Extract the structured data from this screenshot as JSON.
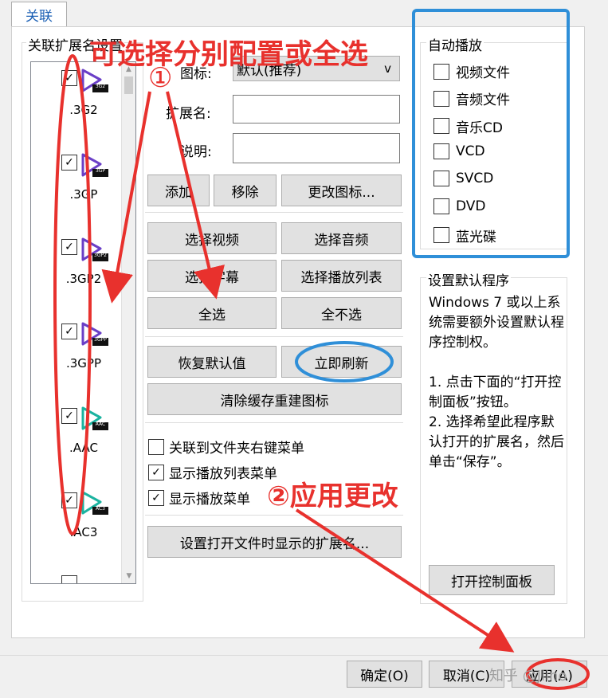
{
  "tab": {
    "label": "关联"
  },
  "left_group": {
    "legend": "关联扩展名设置",
    "extensions": [
      {
        "name": ".3G2",
        "badge": "3G2",
        "checked": true,
        "icon": "purple-play-icon",
        "color": "#6a3fc7"
      },
      {
        "name": ".3GP",
        "badge": "3GP",
        "checked": true,
        "icon": "purple-play-icon",
        "color": "#6a3fc7"
      },
      {
        "name": ".3GP2",
        "badge": "3GP2",
        "checked": true,
        "icon": "purple-play-icon",
        "color": "#6a3fc7"
      },
      {
        "name": ".3GPP",
        "badge": "3GPP",
        "checked": true,
        "icon": "purple-play-icon",
        "color": "#6a3fc7"
      },
      {
        "name": ".AAC",
        "badge": "AAC",
        "checked": true,
        "icon": "teal-play-icon",
        "color": "#1bb3a0"
      },
      {
        "name": ".AC3",
        "badge": "AC3",
        "checked": true,
        "icon": "teal-play-icon",
        "color": "#1bb3a0"
      }
    ]
  },
  "form": {
    "icon_label": "图标:",
    "icon_value": "默认(推荐)",
    "ext_label": "扩展名:",
    "ext_value": "",
    "desc_label": "说明:",
    "desc_value": ""
  },
  "buttons": {
    "add": "添加",
    "remove": "移除",
    "change_icon": "更改图标...",
    "select_video": "选择视频",
    "select_audio": "选择音频",
    "select_subtitle": "选择字幕",
    "select_playlist": "选择播放列表",
    "select_all": "全选",
    "select_none": "全不选",
    "restore_defaults": "恢复默认值",
    "refresh_now": "立即刷新",
    "clear_cache": "清除缓存重建图标",
    "set_open_ext": "设置打开文件时显示的扩展名...",
    "open_control_panel": "打开控制面板",
    "ok": "确定(O)",
    "cancel": "取消(C)",
    "apply": "应用(A)"
  },
  "options": [
    {
      "label": "关联到文件夹右键菜单",
      "checked": false
    },
    {
      "label": "显示播放列表菜单",
      "checked": true
    },
    {
      "label": "显示播放菜单",
      "checked": true
    }
  ],
  "autoplay": {
    "legend": "自动播放",
    "items": [
      {
        "label": "视频文件",
        "checked": false
      },
      {
        "label": "音频文件",
        "checked": false
      },
      {
        "label": "音乐CD",
        "checked": false
      },
      {
        "label": "VCD",
        "checked": false
      },
      {
        "label": "SVCD",
        "checked": false
      },
      {
        "label": "DVD",
        "checked": false
      },
      {
        "label": "蓝光碟",
        "checked": false
      }
    ]
  },
  "default_program": {
    "legend": "设置默认程序",
    "text1": "Windows 7 或以上系统需要额外设置默认程序控制权。",
    "text2": "1. 点击下面的“打开控制面板”按钮。",
    "text3": "2. 选择希望此程序默认打开的扩展名，然后单击“保存”。"
  },
  "annotations": {
    "title": "可选择分别配置或全选",
    "marker1": "①",
    "marker2": "②应用更改",
    "watermark": "知乎 @Jlino",
    "color": "#e8312d",
    "highlight_color": "#2f8fd8"
  }
}
